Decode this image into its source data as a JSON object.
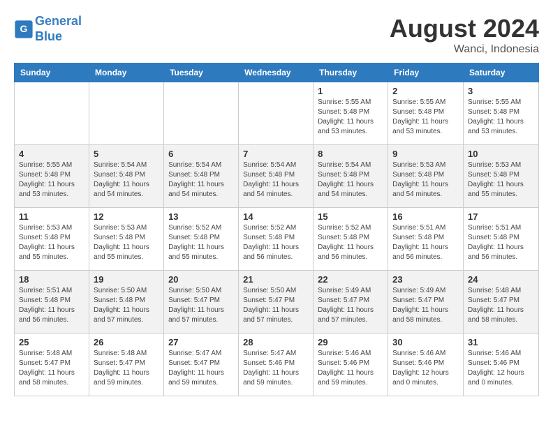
{
  "header": {
    "logo_line1": "General",
    "logo_line2": "Blue",
    "month_year": "August 2024",
    "location": "Wanci, Indonesia"
  },
  "days_of_week": [
    "Sunday",
    "Monday",
    "Tuesday",
    "Wednesday",
    "Thursday",
    "Friday",
    "Saturday"
  ],
  "weeks": [
    [
      {
        "day": "",
        "info": ""
      },
      {
        "day": "",
        "info": ""
      },
      {
        "day": "",
        "info": ""
      },
      {
        "day": "",
        "info": ""
      },
      {
        "day": "1",
        "info": "Sunrise: 5:55 AM\nSunset: 5:48 PM\nDaylight: 11 hours\nand 53 minutes."
      },
      {
        "day": "2",
        "info": "Sunrise: 5:55 AM\nSunset: 5:48 PM\nDaylight: 11 hours\nand 53 minutes."
      },
      {
        "day": "3",
        "info": "Sunrise: 5:55 AM\nSunset: 5:48 PM\nDaylight: 11 hours\nand 53 minutes."
      }
    ],
    [
      {
        "day": "4",
        "info": "Sunrise: 5:55 AM\nSunset: 5:48 PM\nDaylight: 11 hours\nand 53 minutes."
      },
      {
        "day": "5",
        "info": "Sunrise: 5:54 AM\nSunset: 5:48 PM\nDaylight: 11 hours\nand 54 minutes."
      },
      {
        "day": "6",
        "info": "Sunrise: 5:54 AM\nSunset: 5:48 PM\nDaylight: 11 hours\nand 54 minutes."
      },
      {
        "day": "7",
        "info": "Sunrise: 5:54 AM\nSunset: 5:48 PM\nDaylight: 11 hours\nand 54 minutes."
      },
      {
        "day": "8",
        "info": "Sunrise: 5:54 AM\nSunset: 5:48 PM\nDaylight: 11 hours\nand 54 minutes."
      },
      {
        "day": "9",
        "info": "Sunrise: 5:53 AM\nSunset: 5:48 PM\nDaylight: 11 hours\nand 54 minutes."
      },
      {
        "day": "10",
        "info": "Sunrise: 5:53 AM\nSunset: 5:48 PM\nDaylight: 11 hours\nand 55 minutes."
      }
    ],
    [
      {
        "day": "11",
        "info": "Sunrise: 5:53 AM\nSunset: 5:48 PM\nDaylight: 11 hours\nand 55 minutes."
      },
      {
        "day": "12",
        "info": "Sunrise: 5:53 AM\nSunset: 5:48 PM\nDaylight: 11 hours\nand 55 minutes."
      },
      {
        "day": "13",
        "info": "Sunrise: 5:52 AM\nSunset: 5:48 PM\nDaylight: 11 hours\nand 55 minutes."
      },
      {
        "day": "14",
        "info": "Sunrise: 5:52 AM\nSunset: 5:48 PM\nDaylight: 11 hours\nand 56 minutes."
      },
      {
        "day": "15",
        "info": "Sunrise: 5:52 AM\nSunset: 5:48 PM\nDaylight: 11 hours\nand 56 minutes."
      },
      {
        "day": "16",
        "info": "Sunrise: 5:51 AM\nSunset: 5:48 PM\nDaylight: 11 hours\nand 56 minutes."
      },
      {
        "day": "17",
        "info": "Sunrise: 5:51 AM\nSunset: 5:48 PM\nDaylight: 11 hours\nand 56 minutes."
      }
    ],
    [
      {
        "day": "18",
        "info": "Sunrise: 5:51 AM\nSunset: 5:48 PM\nDaylight: 11 hours\nand 56 minutes."
      },
      {
        "day": "19",
        "info": "Sunrise: 5:50 AM\nSunset: 5:48 PM\nDaylight: 11 hours\nand 57 minutes."
      },
      {
        "day": "20",
        "info": "Sunrise: 5:50 AM\nSunset: 5:47 PM\nDaylight: 11 hours\nand 57 minutes."
      },
      {
        "day": "21",
        "info": "Sunrise: 5:50 AM\nSunset: 5:47 PM\nDaylight: 11 hours\nand 57 minutes."
      },
      {
        "day": "22",
        "info": "Sunrise: 5:49 AM\nSunset: 5:47 PM\nDaylight: 11 hours\nand 57 minutes."
      },
      {
        "day": "23",
        "info": "Sunrise: 5:49 AM\nSunset: 5:47 PM\nDaylight: 11 hours\nand 58 minutes."
      },
      {
        "day": "24",
        "info": "Sunrise: 5:48 AM\nSunset: 5:47 PM\nDaylight: 11 hours\nand 58 minutes."
      }
    ],
    [
      {
        "day": "25",
        "info": "Sunrise: 5:48 AM\nSunset: 5:47 PM\nDaylight: 11 hours\nand 58 minutes."
      },
      {
        "day": "26",
        "info": "Sunrise: 5:48 AM\nSunset: 5:47 PM\nDaylight: 11 hours\nand 59 minutes."
      },
      {
        "day": "27",
        "info": "Sunrise: 5:47 AM\nSunset: 5:47 PM\nDaylight: 11 hours\nand 59 minutes."
      },
      {
        "day": "28",
        "info": "Sunrise: 5:47 AM\nSunset: 5:46 PM\nDaylight: 11 hours\nand 59 minutes."
      },
      {
        "day": "29",
        "info": "Sunrise: 5:46 AM\nSunset: 5:46 PM\nDaylight: 11 hours\nand 59 minutes."
      },
      {
        "day": "30",
        "info": "Sunrise: 5:46 AM\nSunset: 5:46 PM\nDaylight: 12 hours\nand 0 minutes."
      },
      {
        "day": "31",
        "info": "Sunrise: 5:46 AM\nSunset: 5:46 PM\nDaylight: 12 hours\nand 0 minutes."
      }
    ]
  ]
}
